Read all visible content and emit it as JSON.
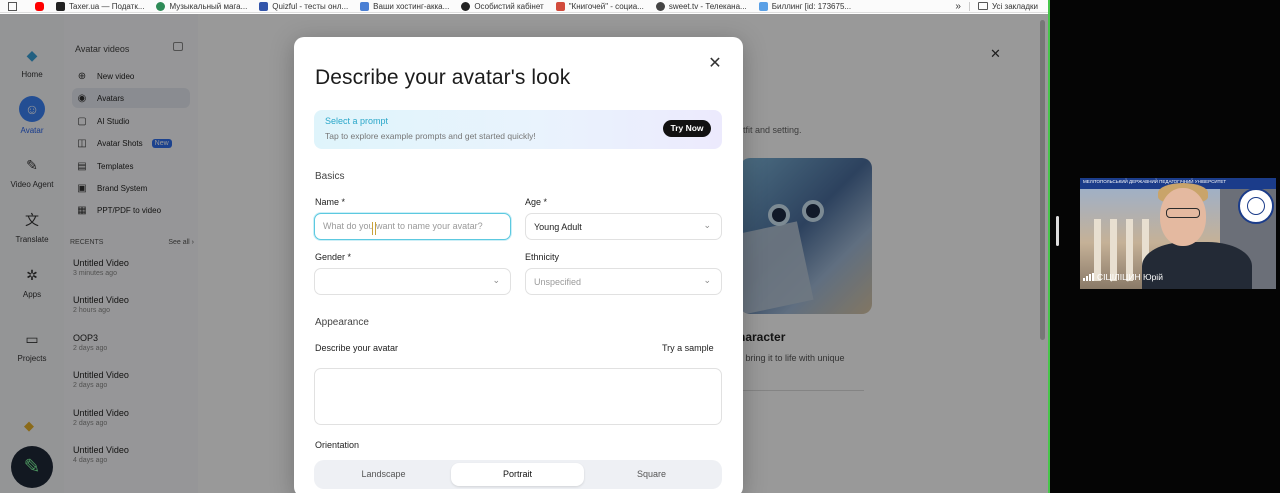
{
  "bookmarks": {
    "items": [
      {
        "label": "",
        "color": "#ff0000",
        "icon": "youtube-icon"
      },
      {
        "label": "Taxer.ua — Податк...",
        "color": "#222222",
        "icon": "taxer-icon"
      },
      {
        "label": "Музыкальный мага...",
        "color": "#2e8b57",
        "icon": "music-icon"
      },
      {
        "label": "Quizful - тесты онл...",
        "color": "#3355aa",
        "icon": "quizful-icon"
      },
      {
        "label": "Ваши хостинг-акка...",
        "color": "#4a7fd4",
        "icon": "hosting-icon"
      },
      {
        "label": "Особистий кабінет",
        "color": "#222222",
        "icon": "cabinet-icon"
      },
      {
        "label": "\"Книгочей\" - социа...",
        "color": "#d24b3c",
        "icon": "book-icon"
      },
      {
        "label": "sweet.tv - Телекана...",
        "color": "#444444",
        "icon": "sweettv-icon"
      },
      {
        "label": "Биллинг [id: 173675...",
        "color": "#5aa0e6",
        "icon": "billing-icon"
      }
    ],
    "more": "»",
    "all_bookmarks": "Усі закладки"
  },
  "rail": {
    "home": "Home",
    "avatar": "Avatar",
    "video_agent": "Video Agent",
    "translate": "Translate",
    "apps": "Apps",
    "projects": "Projects"
  },
  "sidebar": {
    "header": "Avatar videos",
    "items": [
      {
        "label": "New video",
        "icon": "plus-icon"
      },
      {
        "label": "Avatars",
        "icon": "avatar-icon"
      },
      {
        "label": "AI Studio",
        "icon": "studio-icon"
      },
      {
        "label": "Avatar Shots",
        "icon": "camera-icon",
        "badge": "New"
      },
      {
        "label": "Templates",
        "icon": "templates-icon"
      },
      {
        "label": "Brand System",
        "icon": "brand-icon"
      },
      {
        "label": "PPT/PDF to video",
        "icon": "document-icon"
      }
    ],
    "recents_label": "RECENTS",
    "see_all": "See all ›",
    "recents": [
      {
        "title": "Untitled Video",
        "time": "3 minutes ago"
      },
      {
        "title": "Untitled Video",
        "time": "2 hours ago"
      },
      {
        "title": "ООР3",
        "time": "2 days ago"
      },
      {
        "title": "Untitled Video",
        "time": "2 days ago"
      },
      {
        "title": "Untitled Video",
        "time": "2 days ago"
      },
      {
        "title": "Untitled Video",
        "time": "4 days ago"
      }
    ]
  },
  "background": {
    "subtitle_fragment": "utfit and setting.",
    "card_title_fragment": "haracter",
    "card_desc_fragment": "d bring it to life with unique"
  },
  "modal": {
    "title": "Describe your avatar's look",
    "prompt_title": "Select a prompt",
    "prompt_sub": "Tap to explore example prompts and get started quickly!",
    "try_now": "Try Now",
    "basics": "Basics",
    "name_label": "Name *",
    "name_placeholder": "What do you want to name your avatar?",
    "age_label": "Age *",
    "age_value": "Young Adult",
    "gender_label": "Gender *",
    "gender_value": "",
    "ethnicity_label": "Ethnicity",
    "ethnicity_value": "Unspecified",
    "appearance": "Appearance",
    "describe_label": "Describe your avatar",
    "try_sample": "Try a sample",
    "orientation_label": "Orientation",
    "orientation_options": [
      "Landscape",
      "Portrait",
      "Square"
    ],
    "orientation_selected": "Portrait"
  },
  "video_tile": {
    "participant_name": "СІЦІЛІЦИН Юрій",
    "header_text": "МЕЛІТОПОЛЬСЬКИЙ ДЕРЖАВНИЙ ПЕДАГОГІЧНИЙ УНІВЕРСИТЕТ"
  },
  "colors": {
    "accent": "#2aa7c9",
    "active_border": "#47c64b",
    "primary_button": "#111111"
  }
}
